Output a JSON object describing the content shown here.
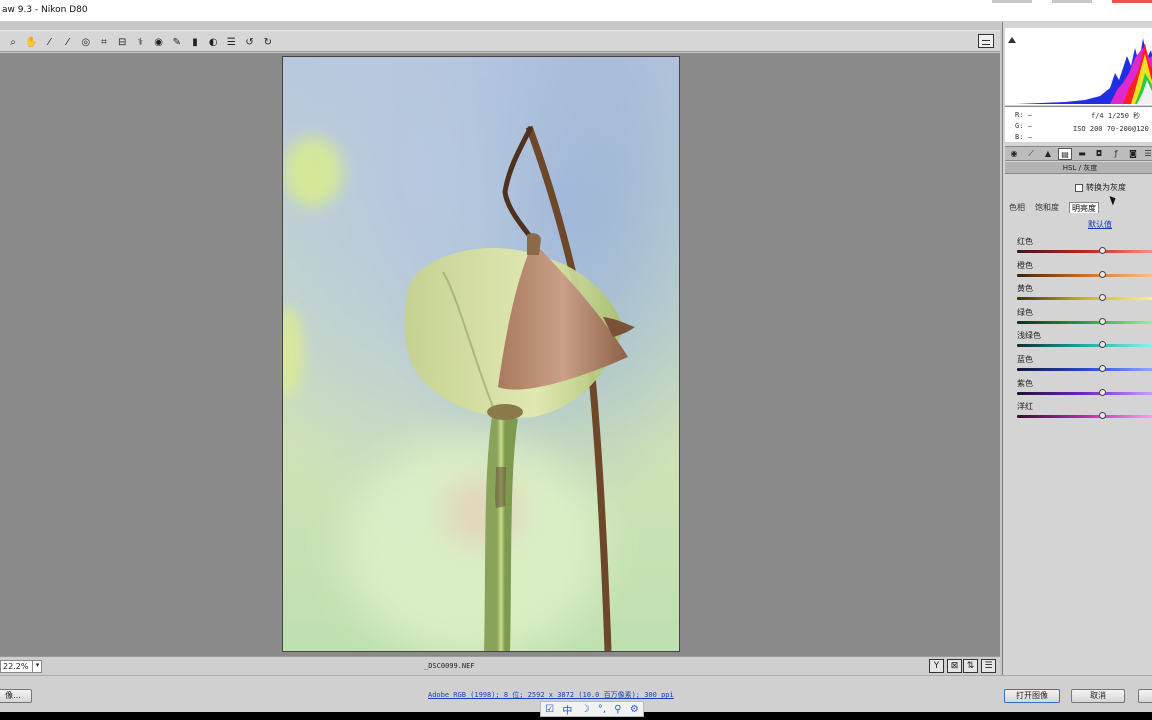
{
  "window": {
    "title": "aw 9.3 -  Nikon D80"
  },
  "toolbar": {
    "tools": [
      {
        "name": "zoom-tool",
        "icon": "magnifier-icon",
        "glyph": "⌕"
      },
      {
        "name": "hand-tool",
        "icon": "hand-icon",
        "glyph": "✋"
      },
      {
        "name": "white-balance-tool",
        "icon": "eyedropper-icon",
        "glyph": "⁄"
      },
      {
        "name": "color-sampler-tool",
        "icon": "color-sampler-icon",
        "glyph": "⁄"
      },
      {
        "name": "targeted-adjustment-tool",
        "icon": "target-icon",
        "glyph": "◎"
      },
      {
        "name": "crop-tool",
        "icon": "crop-icon",
        "glyph": "⌗"
      },
      {
        "name": "straighten-tool",
        "icon": "straighten-icon",
        "glyph": "⊟"
      },
      {
        "name": "spot-removal-tool",
        "icon": "spot-removal-icon",
        "glyph": "⚕"
      },
      {
        "name": "red-eye-tool",
        "icon": "red-eye-icon",
        "glyph": "◉"
      },
      {
        "name": "adjustment-brush-tool",
        "icon": "brush-icon",
        "glyph": "✎"
      },
      {
        "name": "graduated-filter-tool",
        "icon": "graduated-filter-icon",
        "glyph": "▮"
      },
      {
        "name": "preferences-tool",
        "icon": "preferences-icon",
        "glyph": "◐"
      },
      {
        "name": "list-tool",
        "icon": "list-icon",
        "glyph": "☰"
      },
      {
        "name": "rotate-left-tool",
        "icon": "rotate-left-icon",
        "glyph": "↺"
      },
      {
        "name": "rotate-right-tool",
        "icon": "rotate-right-icon",
        "glyph": "↻"
      }
    ]
  },
  "status": {
    "zoom": "22.2%",
    "filename": "_DSC0099.NEF"
  },
  "camera": {
    "r": "R: —",
    "g": "G: —",
    "b": "B: —",
    "aperture_shutter": "f/4  1/250 秒",
    "iso_lens": "ISO 200  70-200@120"
  },
  "panel": {
    "title": "HSL / 灰度",
    "convert_gray": "转换为灰度",
    "subtabs": [
      "色相",
      "饱和度",
      "明亮度"
    ],
    "active_subtab": "明亮度",
    "default_link": "默认值",
    "sliders": [
      {
        "label": "红色",
        "value": 0,
        "track": "linear-gradient(90deg,#3a1a1a,#c02222,#ff8a8a)"
      },
      {
        "label": "橙色",
        "value": 0,
        "track": "linear-gradient(90deg,#3a2410,#d07020,#ffc08a)"
      },
      {
        "label": "黄色",
        "value": 0,
        "track": "linear-gradient(90deg,#3a3410,#c8b820,#fff08a)"
      },
      {
        "label": "绿色",
        "value": 0,
        "track": "linear-gradient(90deg,#10301a,#28a040,#9af0a8)"
      },
      {
        "label": "浅绿色",
        "value": 0,
        "track": "linear-gradient(90deg,#103030,#20a8a8,#90f0f0)"
      },
      {
        "label": "蓝色",
        "value": 0,
        "track": "linear-gradient(90deg,#101838,#2848c8,#90a8ff)"
      },
      {
        "label": "紫色",
        "value": 0,
        "track": "linear-gradient(90deg,#201036,#7028c0,#c8a0ff)"
      },
      {
        "label": "洋红",
        "value": 0,
        "track": "linear-gradient(90deg,#361030,#c028a8,#ffa0e8)"
      }
    ]
  },
  "bottom": {
    "save_label": "像...",
    "workflow_link": "Adobe RGB (1998); 8 位; 2592 x 3872 (10.0 百万像素); 300 ppi",
    "open_label": "打开图像",
    "cancel_label": "取消"
  },
  "ime": {
    "items": [
      "☑",
      "中",
      "☽",
      "°,",
      "⚲",
      "⚙"
    ]
  }
}
